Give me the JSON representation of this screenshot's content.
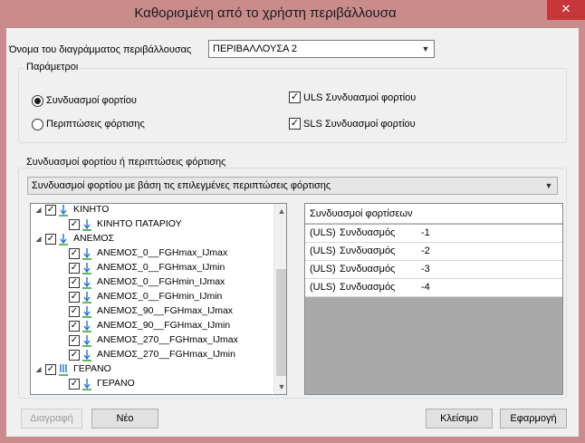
{
  "window": {
    "title": "Καθορισμένη από το χρήστη περιβάλλουσα",
    "close_glyph": "✕"
  },
  "envelope": {
    "name_label": "Όνομα του διαγράμματος περιβάλλουσας",
    "name_value": "ΠΕΡΙΒΑΛΛΟΥΣΑ 2"
  },
  "parameters": {
    "legend": "Παράμετροι",
    "radio_combinations": "Συνδυασμοί φορτίου",
    "radio_cases": "Περιπτώσεις φόρτισης",
    "radio_selected": "combinations",
    "uls_label": "ULS Συνδυασμοί φορτίου",
    "uls_checked": true,
    "sls_label": "SLS Συνδυασμοί φορτίου",
    "sls_checked": true
  },
  "selection": {
    "legend": "Συνδυασμοί φορτίου ή περιπτώσεις φόρτισης",
    "mode_value": "Συνδυασμοί φορτίου με βάση τις επιλεγμένες περιπτώσεις φόρτισης"
  },
  "tree": {
    "items": [
      {
        "label": "ΚΙΝΗΤΟ",
        "level": 0,
        "checked": true,
        "expanded": true,
        "icon": "load-arrow-icon"
      },
      {
        "label": "ΚΙΝΗΤΟ ΠΑΤΑΡΙΟΥ",
        "level": 1,
        "checked": true,
        "icon": "load-arrow-icon"
      },
      {
        "label": "ΑΝΕΜΟΣ",
        "level": 0,
        "checked": true,
        "expanded": true,
        "icon": "load-arrow-icon"
      },
      {
        "label": "ΑΝΕΜΟΣ_0__FGHmax_IJmax",
        "level": 1,
        "checked": true,
        "icon": "load-arrow-icon"
      },
      {
        "label": "ΑΝΕΜΟΣ_0__FGHmax_IJmin",
        "level": 1,
        "checked": true,
        "icon": "load-arrow-icon"
      },
      {
        "label": "ΑΝΕΜΟΣ_0__FGHmin_IJmax",
        "level": 1,
        "checked": true,
        "icon": "load-arrow-icon"
      },
      {
        "label": "ΑΝΕΜΟΣ_0__FGHmin_IJmin",
        "level": 1,
        "checked": true,
        "icon": "load-arrow-icon"
      },
      {
        "label": "ΑΝΕΜΟΣ_90__FGHmax_IJmax",
        "level": 1,
        "checked": true,
        "icon": "load-arrow-icon"
      },
      {
        "label": "ΑΝΕΜΟΣ_90__FGHmax_IJmin",
        "level": 1,
        "checked": true,
        "icon": "load-arrow-icon"
      },
      {
        "label": "ΑΝΕΜΟΣ_270__FGHmax_IJmax",
        "level": 1,
        "checked": true,
        "icon": "load-arrow-icon"
      },
      {
        "label": "ΑΝΕΜΟΣ_270__FGHmax_IJmin",
        "level": 1,
        "checked": true,
        "icon": "load-arrow-icon"
      },
      {
        "label": "ΓΕΡΑΝΟ",
        "level": 0,
        "checked": true,
        "expanded": true,
        "icon": "multi-load-arrow-icon"
      },
      {
        "label": "ΓΕΡΑΝΟ",
        "level": 1,
        "checked": true,
        "icon": "load-arrow-icon"
      }
    ]
  },
  "combinations": {
    "header": "Συνδυασμοί φορτίσεων",
    "rows": [
      {
        "type": "(ULS)",
        "name": "Συνδυασμός",
        "number": "-1"
      },
      {
        "type": "(ULS)",
        "name": "Συνδυασμός",
        "number": "-2"
      },
      {
        "type": "(ULS)",
        "name": "Συνδυασμός",
        "number": "-3"
      },
      {
        "type": "(ULS)",
        "name": "Συνδυασμός",
        "number": "-4"
      }
    ]
  },
  "buttons": {
    "delete": "Διαγραφή",
    "new": "Νέο",
    "close": "Κλείσιμο",
    "apply": "Εφαρμογή"
  },
  "colors": {
    "title_bar": "#c98c8b",
    "close_button": "#c7373a",
    "load_arrow": "#1e6fd9",
    "load_ground": "#2aa12a",
    "grid_empty": "#a9a9a9"
  }
}
